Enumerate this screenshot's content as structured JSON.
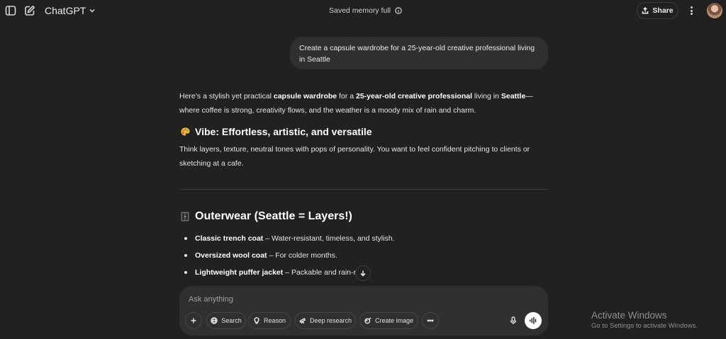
{
  "header": {
    "model_name": "ChatGPT",
    "memory_status": "Saved memory full",
    "share_label": "Share"
  },
  "conversation": {
    "user_message": "Create a capsule wardrobe for a 25-year-old creative professional living in Seattle",
    "intro": {
      "t1": "Here’s a stylish yet practical ",
      "b1": "capsule wardrobe",
      "t2": " for a ",
      "b2": "25-year-old creative professional",
      "t3": " living in ",
      "b3": "Seattle",
      "t4": "—where coffee is strong, creativity flows, and the weather is a moody mix of rain and charm."
    },
    "vibe_heading": "Vibe: Effortless, artistic, and versatile",
    "vibe_text": "Think layers, texture, neutral tones with pops of personality. You want to feel confident pitching to clients or sketching at a cafe.",
    "outerwear_heading": "Outerwear (Seattle = Layers!)",
    "outerwear_items": [
      {
        "name": "Classic trench coat",
        "desc": " – Water-resistant, timeless, and stylish."
      },
      {
        "name": "Oversized wool coat",
        "desc": " – For colder months."
      },
      {
        "name": "Lightweight puffer jacket",
        "desc": " – Packable and rain-re"
      }
    ]
  },
  "composer": {
    "placeholder": "Ask anything",
    "tools": {
      "search": "Search",
      "reason": "Reason",
      "deep_research": "Deep research",
      "create_image": "Create image"
    }
  },
  "watermark": {
    "title": "Activate Windows",
    "subtitle": "Go to Settings to activate Windows."
  },
  "icons": {
    "vibe_emoji": "artist-palette",
    "outerwear_emoji": "coat"
  }
}
